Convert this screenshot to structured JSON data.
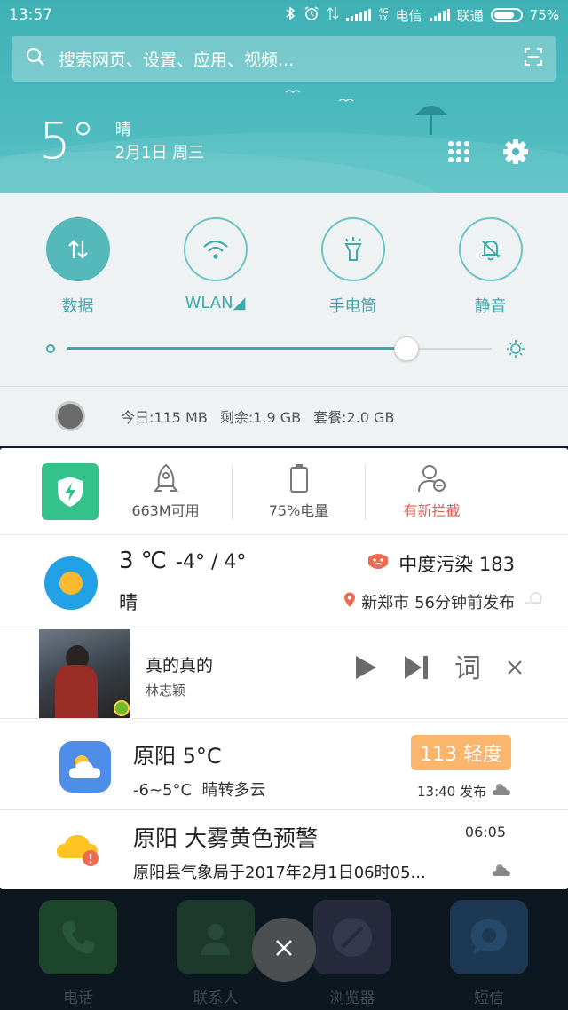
{
  "status_bar": {
    "time": "13:57",
    "network_4g": "4G",
    "network_1x": "1X",
    "carrier1": "电信",
    "carrier2": "联通",
    "battery": "75%"
  },
  "search": {
    "placeholder": "搜索网页、设置、应用、视频..."
  },
  "header_weather": {
    "temp": "5°",
    "condition": "晴",
    "date": "2月1日 周三"
  },
  "quick_settings": {
    "toggles": [
      {
        "label": "数据",
        "icon": "data-arrows-icon",
        "active": true
      },
      {
        "label": "WLAN◢",
        "icon": "wifi-icon",
        "active": false
      },
      {
        "label": "手电筒",
        "icon": "flashlight-icon",
        "active": false
      },
      {
        "label": "静音",
        "icon": "bell-off-icon",
        "active": false
      }
    ],
    "brightness_level": 0.8
  },
  "data_usage": {
    "today": "今日:115 MB",
    "remaining": "剩余:1.9 GB",
    "plan": "套餐:2.0 GB"
  },
  "security": {
    "memory": "663M可用",
    "battery": "75%电量",
    "intercept": "有新拦截",
    "accent": "#34c28a",
    "alert_color": "#e05d4f"
  },
  "weather_card": {
    "temp": "3 ℃",
    "range": "-4° / 4°",
    "condition": "晴",
    "aqi": "中度污染 183",
    "location": "新郑市",
    "published": "56分钟前发布"
  },
  "music": {
    "title": "真的真的",
    "artist": "林志颖",
    "lyric_label": "词"
  },
  "city_weather": {
    "title": "原阳  5°C",
    "range": "-6~5°C",
    "condition": "晴转多云",
    "aqi_badge": "113 轻度",
    "published": "13:40 发布"
  },
  "alert": {
    "title": "原阳 大雾黄色预警",
    "body": "原阳县气象局于2017年2月1日06时05...",
    "time": "06:05"
  },
  "dock": [
    {
      "label": "电话",
      "color": "#1f4a2e"
    },
    {
      "label": "联系人",
      "color": "#1e3d2e"
    },
    {
      "label": "浏览器",
      "color": "#2a2d40"
    },
    {
      "label": "短信",
      "color": "#1f3c59"
    }
  ]
}
